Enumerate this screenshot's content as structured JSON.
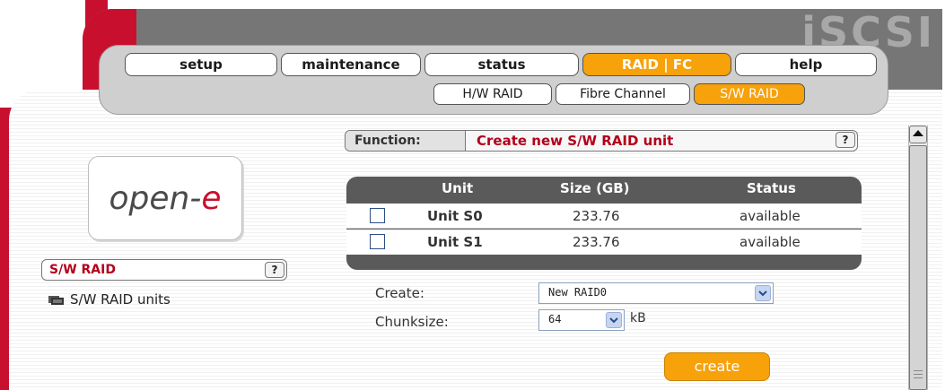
{
  "brand": {
    "title": "iSCSI"
  },
  "nav": {
    "tabs": [
      {
        "label": "setup",
        "active": false
      },
      {
        "label": "maintenance",
        "active": false
      },
      {
        "label": "status",
        "active": false
      },
      {
        "label": "RAID | FC",
        "active": true
      },
      {
        "label": "help",
        "active": false
      }
    ],
    "subtabs": [
      {
        "label": "H/W RAID",
        "active": false
      },
      {
        "label": "Fibre Channel",
        "active": false
      },
      {
        "label": "S/W RAID",
        "active": true
      }
    ]
  },
  "sidebar": {
    "logo_text_main": "open-",
    "logo_text_accent": "e",
    "section_title": "S/W RAID",
    "help_label": "?",
    "tree_item": "S/W RAID units"
  },
  "function": {
    "label": "Function:",
    "value": "Create new S/W RAID unit",
    "help_label": "?"
  },
  "table": {
    "headers": [
      "Unit",
      "Size (GB)",
      "Status"
    ],
    "rows": [
      {
        "checked": false,
        "unit": "Unit S0",
        "size": "233.76",
        "status": "available"
      },
      {
        "checked": false,
        "unit": "Unit S1",
        "size": "233.76",
        "status": "available"
      }
    ]
  },
  "form": {
    "create_label": "Create:",
    "create_value": "New RAID0",
    "chunk_label": "Chunksize:",
    "chunk_value": "64",
    "chunk_unit": "kB",
    "create_button": "create"
  },
  "colors": {
    "accent_orange": "#f7a10b",
    "brand_red": "#c8102e",
    "header_gray": "#767676",
    "title_red": "#b3001b"
  },
  "icons": {
    "scroll_up": "arrow-up-icon",
    "dropdown": "chevron-down-icon",
    "tree_item": "folder-icon"
  }
}
